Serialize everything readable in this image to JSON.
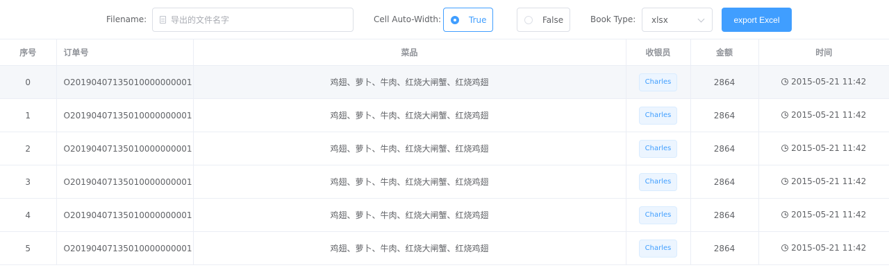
{
  "toolbar": {
    "filename_label": "Filename:",
    "filename_placeholder": "导出的文件名字",
    "filename_value": "",
    "autowidth_label": "Cell Auto-Width:",
    "autowidth_options": [
      "True",
      "False"
    ],
    "autowidth_selected": "True",
    "booktype_label": "Book Type:",
    "booktype_value": "xlsx",
    "export_label": "export Excel"
  },
  "table": {
    "columns": [
      "序号",
      "订单号",
      "菜品",
      "收银员",
      "金额",
      "时间"
    ],
    "rows": [
      {
        "index": "0",
        "order": "O20190407135010000000001",
        "dishes": "鸡翅、萝卜、牛肉、红烧大闸蟹、红烧鸡翅",
        "cashier": "Charles",
        "amount": "2864",
        "time": "2015-05-21 11:42"
      },
      {
        "index": "1",
        "order": "O20190407135010000000001",
        "dishes": "鸡翅、萝卜、牛肉、红烧大闸蟹、红烧鸡翅",
        "cashier": "Charles",
        "amount": "2864",
        "time": "2015-05-21 11:42"
      },
      {
        "index": "2",
        "order": "O20190407135010000000001",
        "dishes": "鸡翅、萝卜、牛肉、红烧大闸蟹、红烧鸡翅",
        "cashier": "Charles",
        "amount": "2864",
        "time": "2015-05-21 11:42"
      },
      {
        "index": "3",
        "order": "O20190407135010000000001",
        "dishes": "鸡翅、萝卜、牛肉、红烧大闸蟹、红烧鸡翅",
        "cashier": "Charles",
        "amount": "2864",
        "time": "2015-05-21 11:42"
      },
      {
        "index": "4",
        "order": "O20190407135010000000001",
        "dishes": "鸡翅、萝卜、牛肉、红烧大闸蟹、红烧鸡翅",
        "cashier": "Charles",
        "amount": "2864",
        "time": "2015-05-21 11:42"
      },
      {
        "index": "5",
        "order": "O20190407135010000000001",
        "dishes": "鸡翅、萝卜、牛肉、红烧大闸蟹、红烧鸡翅",
        "cashier": "Charles",
        "amount": "2864",
        "time": "2015-05-21 11:42"
      }
    ]
  },
  "colors": {
    "primary": "#409eff",
    "border": "#dcdfe6",
    "header_text": "#909399",
    "body_text": "#606266",
    "hover_row": "#f5f7fa",
    "tag_bg": "#ecf5ff"
  },
  "icons": {
    "filename_prefix": "document-icon",
    "select_suffix": "chevron-down-icon",
    "time_prefix": "clock-icon"
  }
}
